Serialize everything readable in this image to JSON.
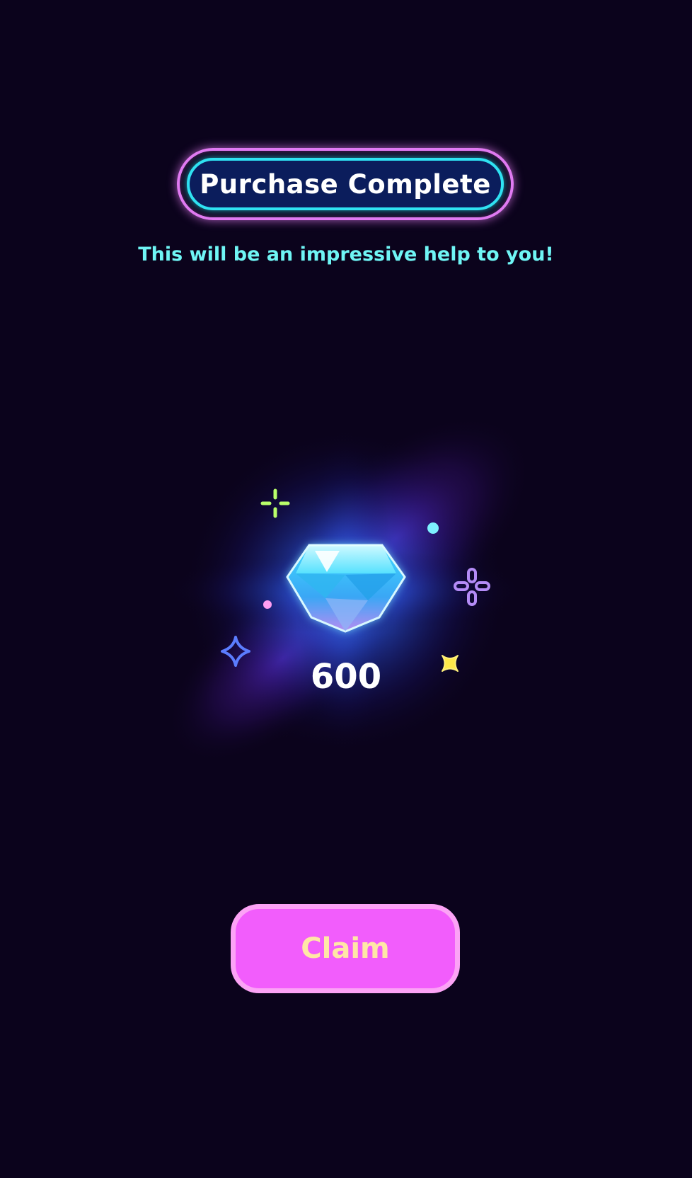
{
  "title": "Purchase Complete",
  "subtitle": "This will be an impressive help to you!",
  "reward": {
    "amount": "600",
    "icon": "diamond-gem-icon"
  },
  "claim_button": {
    "label": "Claim"
  },
  "colors": {
    "background": "#0b031c",
    "title_outer": "#e17af2",
    "title_inner": "#2fe2f2",
    "title_fill": "#0b1d5c",
    "subtitle": "#6ff5f5",
    "button_fill": "#f25dfc",
    "button_border": "#fca3f6",
    "button_text": "#ffe7a6"
  }
}
